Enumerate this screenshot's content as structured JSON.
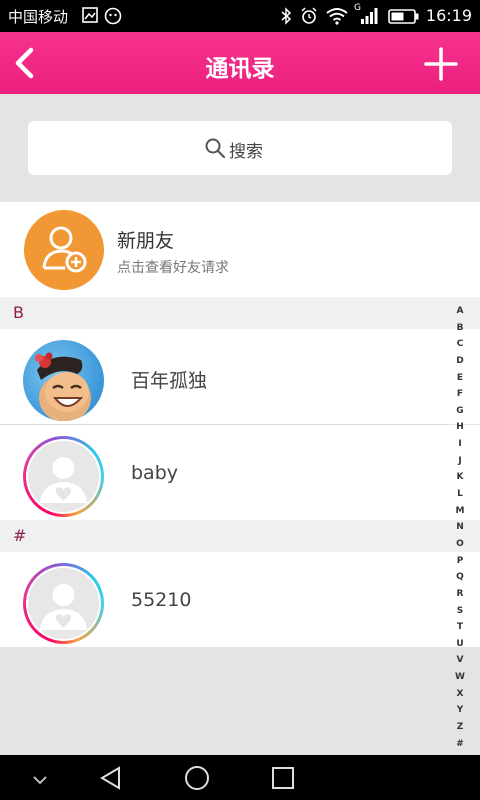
{
  "status_bar": {
    "carrier": "中国移动",
    "time": "16:19",
    "network_type": "G"
  },
  "header": {
    "title": "通讯录"
  },
  "search": {
    "placeholder": "搜索"
  },
  "new_friend": {
    "title": "新朋友",
    "subtitle": "点击查看好友请求"
  },
  "sections": [
    {
      "letter": "B",
      "contacts": [
        {
          "name": "百年孤独",
          "avatar": "cartoon-avatar"
        },
        {
          "name": "baby",
          "avatar": "default-avatar"
        }
      ]
    },
    {
      "letter": "#",
      "contacts": [
        {
          "name": "55210",
          "avatar": "default-avatar"
        }
      ]
    }
  ],
  "alphabet_index": [
    "A",
    "B",
    "C",
    "D",
    "E",
    "F",
    "G",
    "H",
    "I",
    "J",
    "K",
    "L",
    "M",
    "N",
    "O",
    "P",
    "Q",
    "R",
    "S",
    "T",
    "U",
    "V",
    "W",
    "X",
    "Y",
    "Z",
    "#"
  ],
  "colors": {
    "accent": "#ec1f7e",
    "new_friend_avatar": "#f19733",
    "section_letter": "#8b1d4f"
  }
}
